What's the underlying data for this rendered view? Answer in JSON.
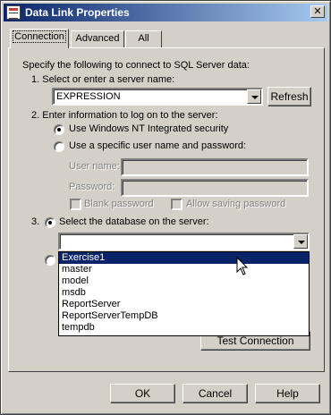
{
  "window": {
    "title": "Data Link Properties",
    "close_glyph": "✕"
  },
  "tabs": [
    {
      "label": "Connection",
      "active": true
    },
    {
      "label": "Advanced",
      "active": false
    },
    {
      "label": "All",
      "active": false
    }
  ],
  "intro": "Specify the following to connect to SQL Server data:",
  "step1": {
    "label": "1. Select or enter a server name:",
    "server_value": "EXPRESSION",
    "refresh_label": "Refresh"
  },
  "step2": {
    "label": "2. Enter information to log on to the server:",
    "option_nt": "Use Windows NT Integrated security",
    "option_specific": "Use a specific user name and password:",
    "username_label": "User name:",
    "password_label": "Password:",
    "blank_password": "Blank password",
    "allow_saving": "Allow saving password"
  },
  "step3": {
    "number": "3.",
    "label": "Select the database on the server:",
    "db_value": ""
  },
  "database_list": [
    "Exercise1",
    "master",
    "model",
    "msdb",
    "ReportServer",
    "ReportServerTempDB",
    "tempdb"
  ],
  "selected_database": "Exercise1",
  "test_connection_label": "Test Connection",
  "footer": {
    "ok": "OK",
    "cancel": "Cancel",
    "help": "Help"
  },
  "colors": {
    "titlebar_start": "#0a246a",
    "titlebar_end": "#a6caf0",
    "selection": "#0a246a",
    "face": "#d4d0c8"
  }
}
